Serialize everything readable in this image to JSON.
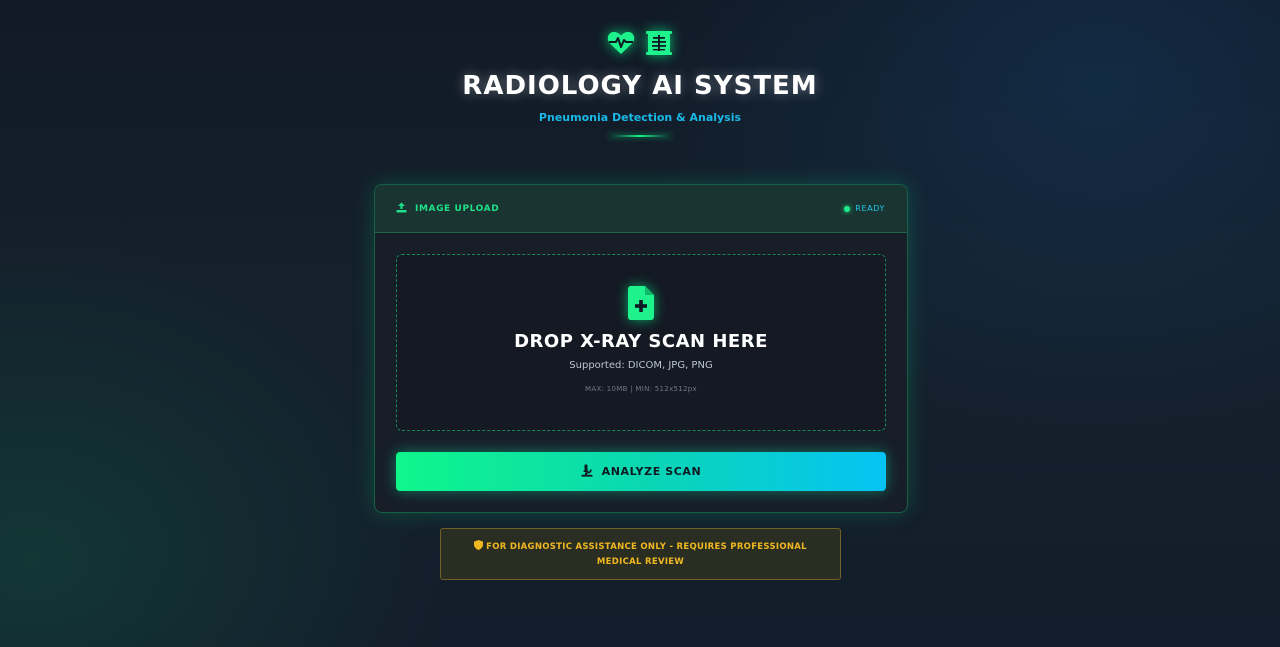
{
  "header": {
    "icons": [
      "heart-pulse-icon",
      "x-ray-icon"
    ],
    "title": "RADIOLOGY AI SYSTEM",
    "subtitle": "Pneumonia Detection & Analysis"
  },
  "upload_card": {
    "title": "IMAGE UPLOAD",
    "title_icon": "upload-icon",
    "status": "READY",
    "dropzone": {
      "icon": "file-plus-icon",
      "title": "DROP X-RAY SCAN HERE",
      "supported": "Supported: DICOM, JPG, PNG",
      "limits": "MAX: 10MB | MIN: 512x512px"
    },
    "analyze_button": {
      "icon": "microscope-icon",
      "label": "ANALYZE SCAN"
    }
  },
  "disclaimer": {
    "icon": "shield-icon",
    "text": "FOR DIAGNOSTIC ASSISTANCE ONLY - REQUIRES PROFESSIONAL MEDICAL REVIEW"
  },
  "colors": {
    "accent_green": "#1ee089",
    "accent_cyan": "#06c3f4",
    "warning": "#f0b820",
    "background": "#131c28"
  }
}
